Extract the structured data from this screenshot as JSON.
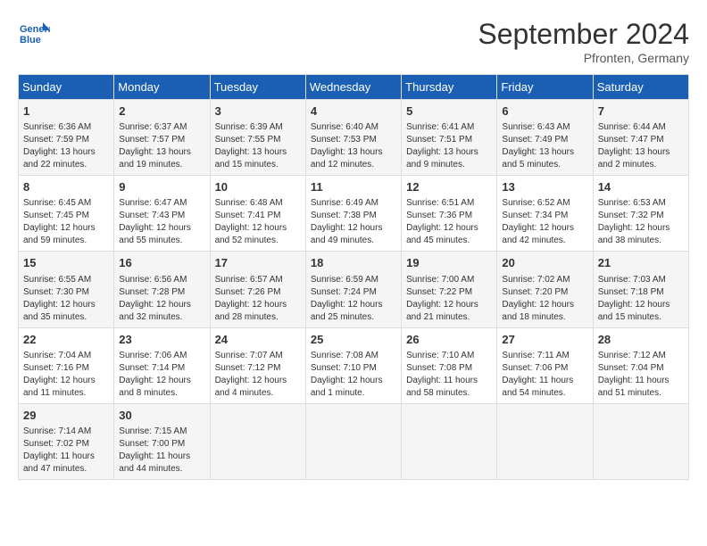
{
  "logo": {
    "line1": "General",
    "line2": "Blue"
  },
  "title": "September 2024",
  "location": "Pfronten, Germany",
  "days_of_week": [
    "Sunday",
    "Monday",
    "Tuesday",
    "Wednesday",
    "Thursday",
    "Friday",
    "Saturday"
  ],
  "weeks": [
    [
      {
        "day": "1",
        "info": "Sunrise: 6:36 AM\nSunset: 7:59 PM\nDaylight: 13 hours\nand 22 minutes."
      },
      {
        "day": "2",
        "info": "Sunrise: 6:37 AM\nSunset: 7:57 PM\nDaylight: 13 hours\nand 19 minutes."
      },
      {
        "day": "3",
        "info": "Sunrise: 6:39 AM\nSunset: 7:55 PM\nDaylight: 13 hours\nand 15 minutes."
      },
      {
        "day": "4",
        "info": "Sunrise: 6:40 AM\nSunset: 7:53 PM\nDaylight: 13 hours\nand 12 minutes."
      },
      {
        "day": "5",
        "info": "Sunrise: 6:41 AM\nSunset: 7:51 PM\nDaylight: 13 hours\nand 9 minutes."
      },
      {
        "day": "6",
        "info": "Sunrise: 6:43 AM\nSunset: 7:49 PM\nDaylight: 13 hours\nand 5 minutes."
      },
      {
        "day": "7",
        "info": "Sunrise: 6:44 AM\nSunset: 7:47 PM\nDaylight: 13 hours\nand 2 minutes."
      }
    ],
    [
      {
        "day": "8",
        "info": "Sunrise: 6:45 AM\nSunset: 7:45 PM\nDaylight: 12 hours\nand 59 minutes."
      },
      {
        "day": "9",
        "info": "Sunrise: 6:47 AM\nSunset: 7:43 PM\nDaylight: 12 hours\nand 55 minutes."
      },
      {
        "day": "10",
        "info": "Sunrise: 6:48 AM\nSunset: 7:41 PM\nDaylight: 12 hours\nand 52 minutes."
      },
      {
        "day": "11",
        "info": "Sunrise: 6:49 AM\nSunset: 7:38 PM\nDaylight: 12 hours\nand 49 minutes."
      },
      {
        "day": "12",
        "info": "Sunrise: 6:51 AM\nSunset: 7:36 PM\nDaylight: 12 hours\nand 45 minutes."
      },
      {
        "day": "13",
        "info": "Sunrise: 6:52 AM\nSunset: 7:34 PM\nDaylight: 12 hours\nand 42 minutes."
      },
      {
        "day": "14",
        "info": "Sunrise: 6:53 AM\nSunset: 7:32 PM\nDaylight: 12 hours\nand 38 minutes."
      }
    ],
    [
      {
        "day": "15",
        "info": "Sunrise: 6:55 AM\nSunset: 7:30 PM\nDaylight: 12 hours\nand 35 minutes."
      },
      {
        "day": "16",
        "info": "Sunrise: 6:56 AM\nSunset: 7:28 PM\nDaylight: 12 hours\nand 32 minutes."
      },
      {
        "day": "17",
        "info": "Sunrise: 6:57 AM\nSunset: 7:26 PM\nDaylight: 12 hours\nand 28 minutes."
      },
      {
        "day": "18",
        "info": "Sunrise: 6:59 AM\nSunset: 7:24 PM\nDaylight: 12 hours\nand 25 minutes."
      },
      {
        "day": "19",
        "info": "Sunrise: 7:00 AM\nSunset: 7:22 PM\nDaylight: 12 hours\nand 21 minutes."
      },
      {
        "day": "20",
        "info": "Sunrise: 7:02 AM\nSunset: 7:20 PM\nDaylight: 12 hours\nand 18 minutes."
      },
      {
        "day": "21",
        "info": "Sunrise: 7:03 AM\nSunset: 7:18 PM\nDaylight: 12 hours\nand 15 minutes."
      }
    ],
    [
      {
        "day": "22",
        "info": "Sunrise: 7:04 AM\nSunset: 7:16 PM\nDaylight: 12 hours\nand 11 minutes."
      },
      {
        "day": "23",
        "info": "Sunrise: 7:06 AM\nSunset: 7:14 PM\nDaylight: 12 hours\nand 8 minutes."
      },
      {
        "day": "24",
        "info": "Sunrise: 7:07 AM\nSunset: 7:12 PM\nDaylight: 12 hours\nand 4 minutes."
      },
      {
        "day": "25",
        "info": "Sunrise: 7:08 AM\nSunset: 7:10 PM\nDaylight: 12 hours\nand 1 minute."
      },
      {
        "day": "26",
        "info": "Sunrise: 7:10 AM\nSunset: 7:08 PM\nDaylight: 11 hours\nand 58 minutes."
      },
      {
        "day": "27",
        "info": "Sunrise: 7:11 AM\nSunset: 7:06 PM\nDaylight: 11 hours\nand 54 minutes."
      },
      {
        "day": "28",
        "info": "Sunrise: 7:12 AM\nSunset: 7:04 PM\nDaylight: 11 hours\nand 51 minutes."
      }
    ],
    [
      {
        "day": "29",
        "info": "Sunrise: 7:14 AM\nSunset: 7:02 PM\nDaylight: 11 hours\nand 47 minutes."
      },
      {
        "day": "30",
        "info": "Sunrise: 7:15 AM\nSunset: 7:00 PM\nDaylight: 11 hours\nand 44 minutes."
      },
      {
        "day": "",
        "info": ""
      },
      {
        "day": "",
        "info": ""
      },
      {
        "day": "",
        "info": ""
      },
      {
        "day": "",
        "info": ""
      },
      {
        "day": "",
        "info": ""
      }
    ]
  ]
}
